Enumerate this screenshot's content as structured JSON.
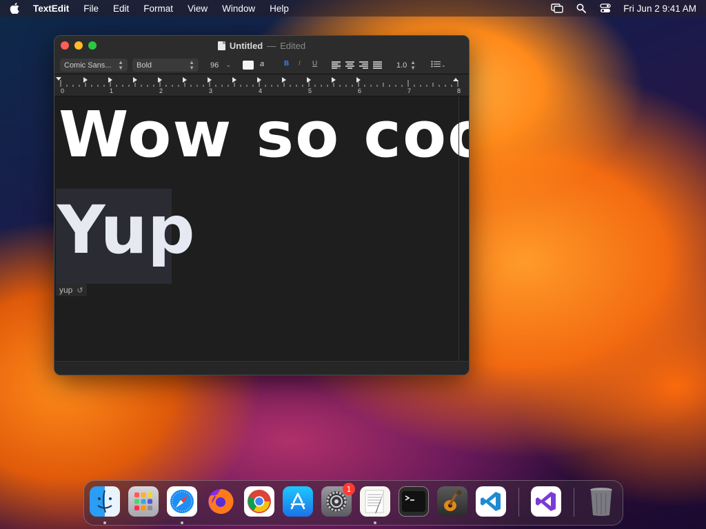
{
  "menubar": {
    "app_name": "TextEdit",
    "menus": [
      "File",
      "Edit",
      "Format",
      "View",
      "Window",
      "Help"
    ],
    "clock": "Fri Jun 2  9:41 AM"
  },
  "window": {
    "title": "Untitled",
    "title_separator": "—",
    "status": "Edited",
    "toolbar": {
      "font": "Comic Sans...",
      "style": "Bold",
      "size": "96",
      "bold_label": "B",
      "italic_label": "I",
      "underline_label": "U",
      "highlight_label": "a",
      "line_spacing": "1.0"
    },
    "ruler_numbers": [
      "0",
      "1",
      "2",
      "3",
      "4",
      "5",
      "6",
      "7",
      "8"
    ],
    "content": {
      "line1": "Wow so cool",
      "line2": "Yup",
      "autocorrect_suggestion": "yup",
      "undo_glyph": "↺"
    }
  },
  "dock": {
    "apps": [
      "Finder",
      "Launchpad",
      "Safari",
      "Firefox",
      "Chrome",
      "App Store",
      "System Settings",
      "TextEdit",
      "Terminal",
      "GarageBand",
      "Visual Studio Code",
      "Visual Studio",
      "Trash"
    ],
    "settings_badge": "1"
  }
}
